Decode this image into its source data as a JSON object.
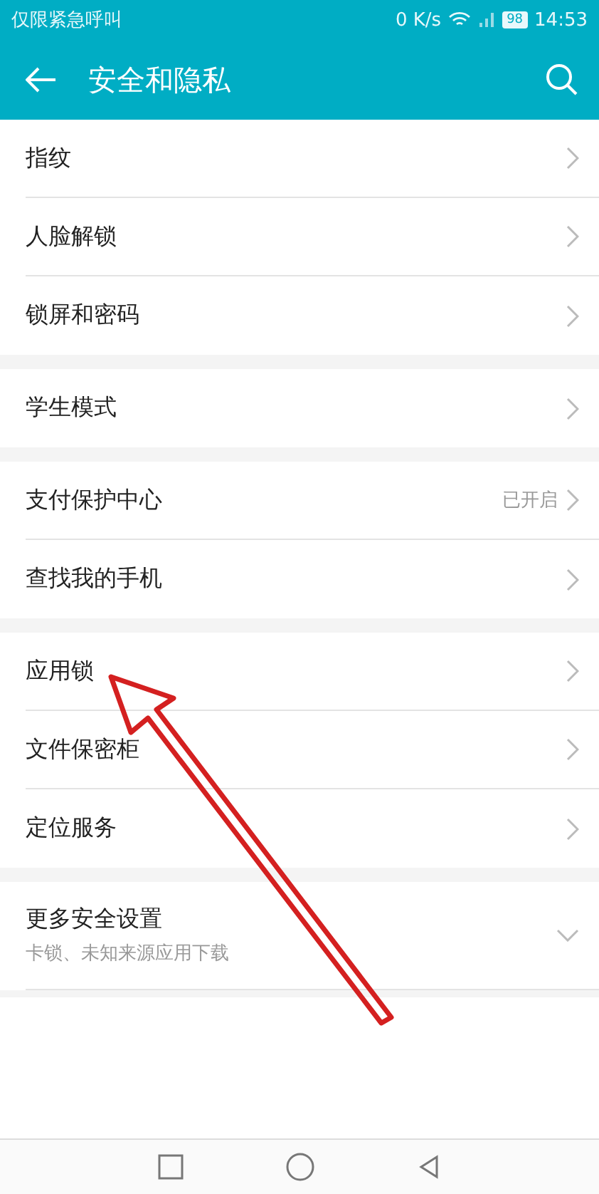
{
  "status_bar": {
    "carrier": "仅限紧急呼叫",
    "speed": "0 K/s",
    "battery": "98",
    "time": "14:53"
  },
  "app_bar": {
    "title": "安全和隐私"
  },
  "groups": [
    {
      "items": [
        {
          "label": "指纹",
          "kind": "link"
        },
        {
          "label": "人脸解锁",
          "kind": "link"
        },
        {
          "label": "锁屏和密码",
          "kind": "link"
        }
      ]
    },
    {
      "items": [
        {
          "label": "学生模式",
          "kind": "link"
        }
      ]
    },
    {
      "items": [
        {
          "label": "支付保护中心",
          "value": "已开启",
          "kind": "link"
        },
        {
          "label": "查找我的手机",
          "kind": "link"
        }
      ]
    },
    {
      "items": [
        {
          "label": "应用锁",
          "kind": "link"
        },
        {
          "label": "文件保密柜",
          "kind": "link"
        },
        {
          "label": "定位服务",
          "kind": "link"
        }
      ]
    },
    {
      "items": [
        {
          "label": "更多安全设置",
          "subtitle": "卡锁、未知来源应用下载",
          "kind": "expand",
          "expanded": false
        }
      ]
    }
  ],
  "annotation": {
    "kind": "arrow"
  }
}
